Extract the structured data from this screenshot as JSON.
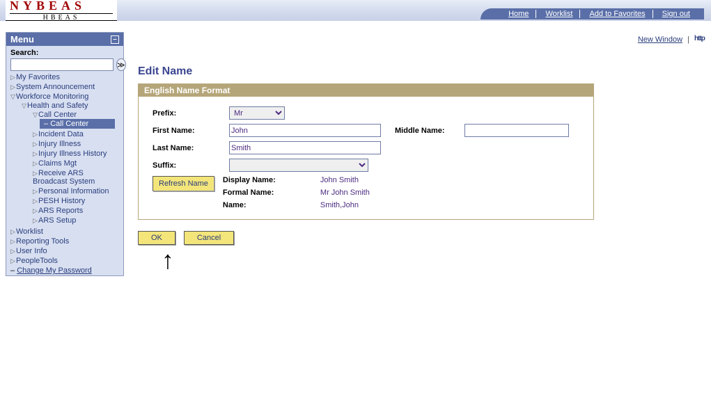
{
  "brand": {
    "main": "NYBEAS",
    "sub": "HBEAS"
  },
  "topnav": {
    "home": "Home",
    "worklist": "Worklist",
    "fav": "Add to Favorites",
    "signout": "Sign out"
  },
  "util": {
    "new_window": "New Window",
    "help_alt": "http"
  },
  "menu": {
    "title": "Menu",
    "search_label": "Search:",
    "items": {
      "myfav": "My Favorites",
      "sysann": "System Announcement",
      "wfmon": "Workforce Monitoring",
      "health": "Health and Safety",
      "callcenter": "Call Center",
      "callcenter_sel": "Call Center",
      "incident": "Incident Data",
      "injury": "Injury Illness",
      "injuryhist": "Injury Illness History",
      "claims": "Claims Mgt",
      "ars": "Receive ARS Broadcast System",
      "pinfo": "Personal Information",
      "pesh": "PESH History",
      "arsrpt": "ARS Reports",
      "arssetup": "ARS Setup",
      "worklist": "Worklist",
      "report": "Reporting Tools",
      "userinfo": "User Info",
      "ptools": "PeopleTools",
      "changepw": "Change My Password"
    }
  },
  "page": {
    "title": "Edit Name",
    "panel_title": "English Name Format",
    "labels": {
      "prefix": "Prefix:",
      "first": "First Name:",
      "middle": "Middle Name:",
      "last": "Last Name:",
      "suffix": "Suffix:",
      "display": "Display Name:",
      "formal": "Formal Name:",
      "name": "Name:"
    },
    "values": {
      "prefix": "Mr",
      "first": "John",
      "middle": "",
      "last": "Smith",
      "suffix": "",
      "display": "John Smith",
      "formal": "Mr John Smith",
      "name": "Smith,John"
    },
    "buttons": {
      "refresh": "Refresh Name",
      "ok": "OK",
      "cancel": "Cancel"
    }
  }
}
